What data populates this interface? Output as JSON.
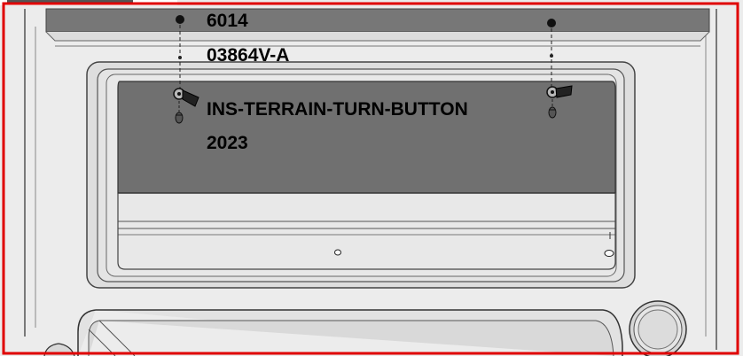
{
  "labels": {
    "code": "6014",
    "part_number": "03864V-A",
    "name": "INS-TERRAIN-TURN-BUTTON",
    "year": "2023"
  },
  "colors": {
    "frame_red": "#e00000",
    "panel_fill": "#e9e9e9",
    "window_dark": "#6f6f6f",
    "top_bar": "#777777",
    "outline": "#333333"
  }
}
